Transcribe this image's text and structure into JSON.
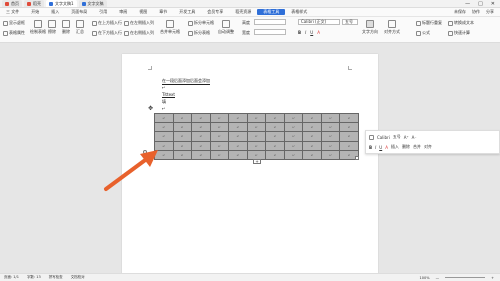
{
  "titlebar": {
    "tabs": [
      {
        "label": "首页",
        "color": "#e04b3a"
      },
      {
        "label": "稻壳",
        "color": "#e04b3a"
      },
      {
        "label": "文字文稿1",
        "color": "#2f6fd8"
      },
      {
        "label": "文字文稿",
        "color": "#2f6fd8"
      }
    ],
    "controls": [
      "—",
      "□",
      "✕"
    ]
  },
  "menubar": {
    "items": [
      "三 文件",
      "开始",
      "插入",
      "页面布局",
      "引用",
      "审阅",
      "视图",
      "章节",
      "开发工具",
      "会员专享",
      "稻壳资源",
      "表格工具",
      "表格样式"
    ],
    "highlight_index": 11,
    "right": [
      "未保存",
      "协作",
      "分享"
    ]
  },
  "ribbon": {
    "row1": [
      "显示虚框",
      "绘制表格",
      "擦除",
      "删除",
      "汇总",
      "在上方插入行",
      "在左侧插入列",
      "合并单元格",
      "拆分单元格",
      "自动调整",
      "高度",
      "宽度",
      "Calibri (正文)",
      "五号",
      "文字方向",
      "对齐方式",
      "标题行重复",
      "转换成文本"
    ],
    "row2": [
      "表格属性",
      "在下方插入行",
      "在右侧插入列",
      "拆分表格",
      "公式",
      "快速计算"
    ],
    "font": "Calibri (正文)",
    "size": "五号"
  },
  "document": {
    "line1": "在一段后面添加后面会添加",
    "line2": "Tittext",
    "line3": "填",
    "line4": "↵"
  },
  "table": {
    "rows": 5,
    "cols": 11,
    "cell_mark": "↵",
    "fill": "#b4b4b4"
  },
  "float_toolbar": {
    "row1": [
      "Calibri",
      "五号",
      "A⁺",
      "A⁻",
      "自动"
    ],
    "row2": [
      "B",
      "I",
      "U",
      "A",
      "插入",
      "删除",
      "合并",
      "对齐"
    ]
  },
  "statusbar": {
    "left": [
      "页面: 1/1",
      "字数: 13",
      "拼写检查",
      "文档校对"
    ],
    "right": [
      "100%",
      "—",
      "+"
    ]
  },
  "colors": {
    "accent": "#2f6fd8",
    "arrow": "#e8612c"
  }
}
